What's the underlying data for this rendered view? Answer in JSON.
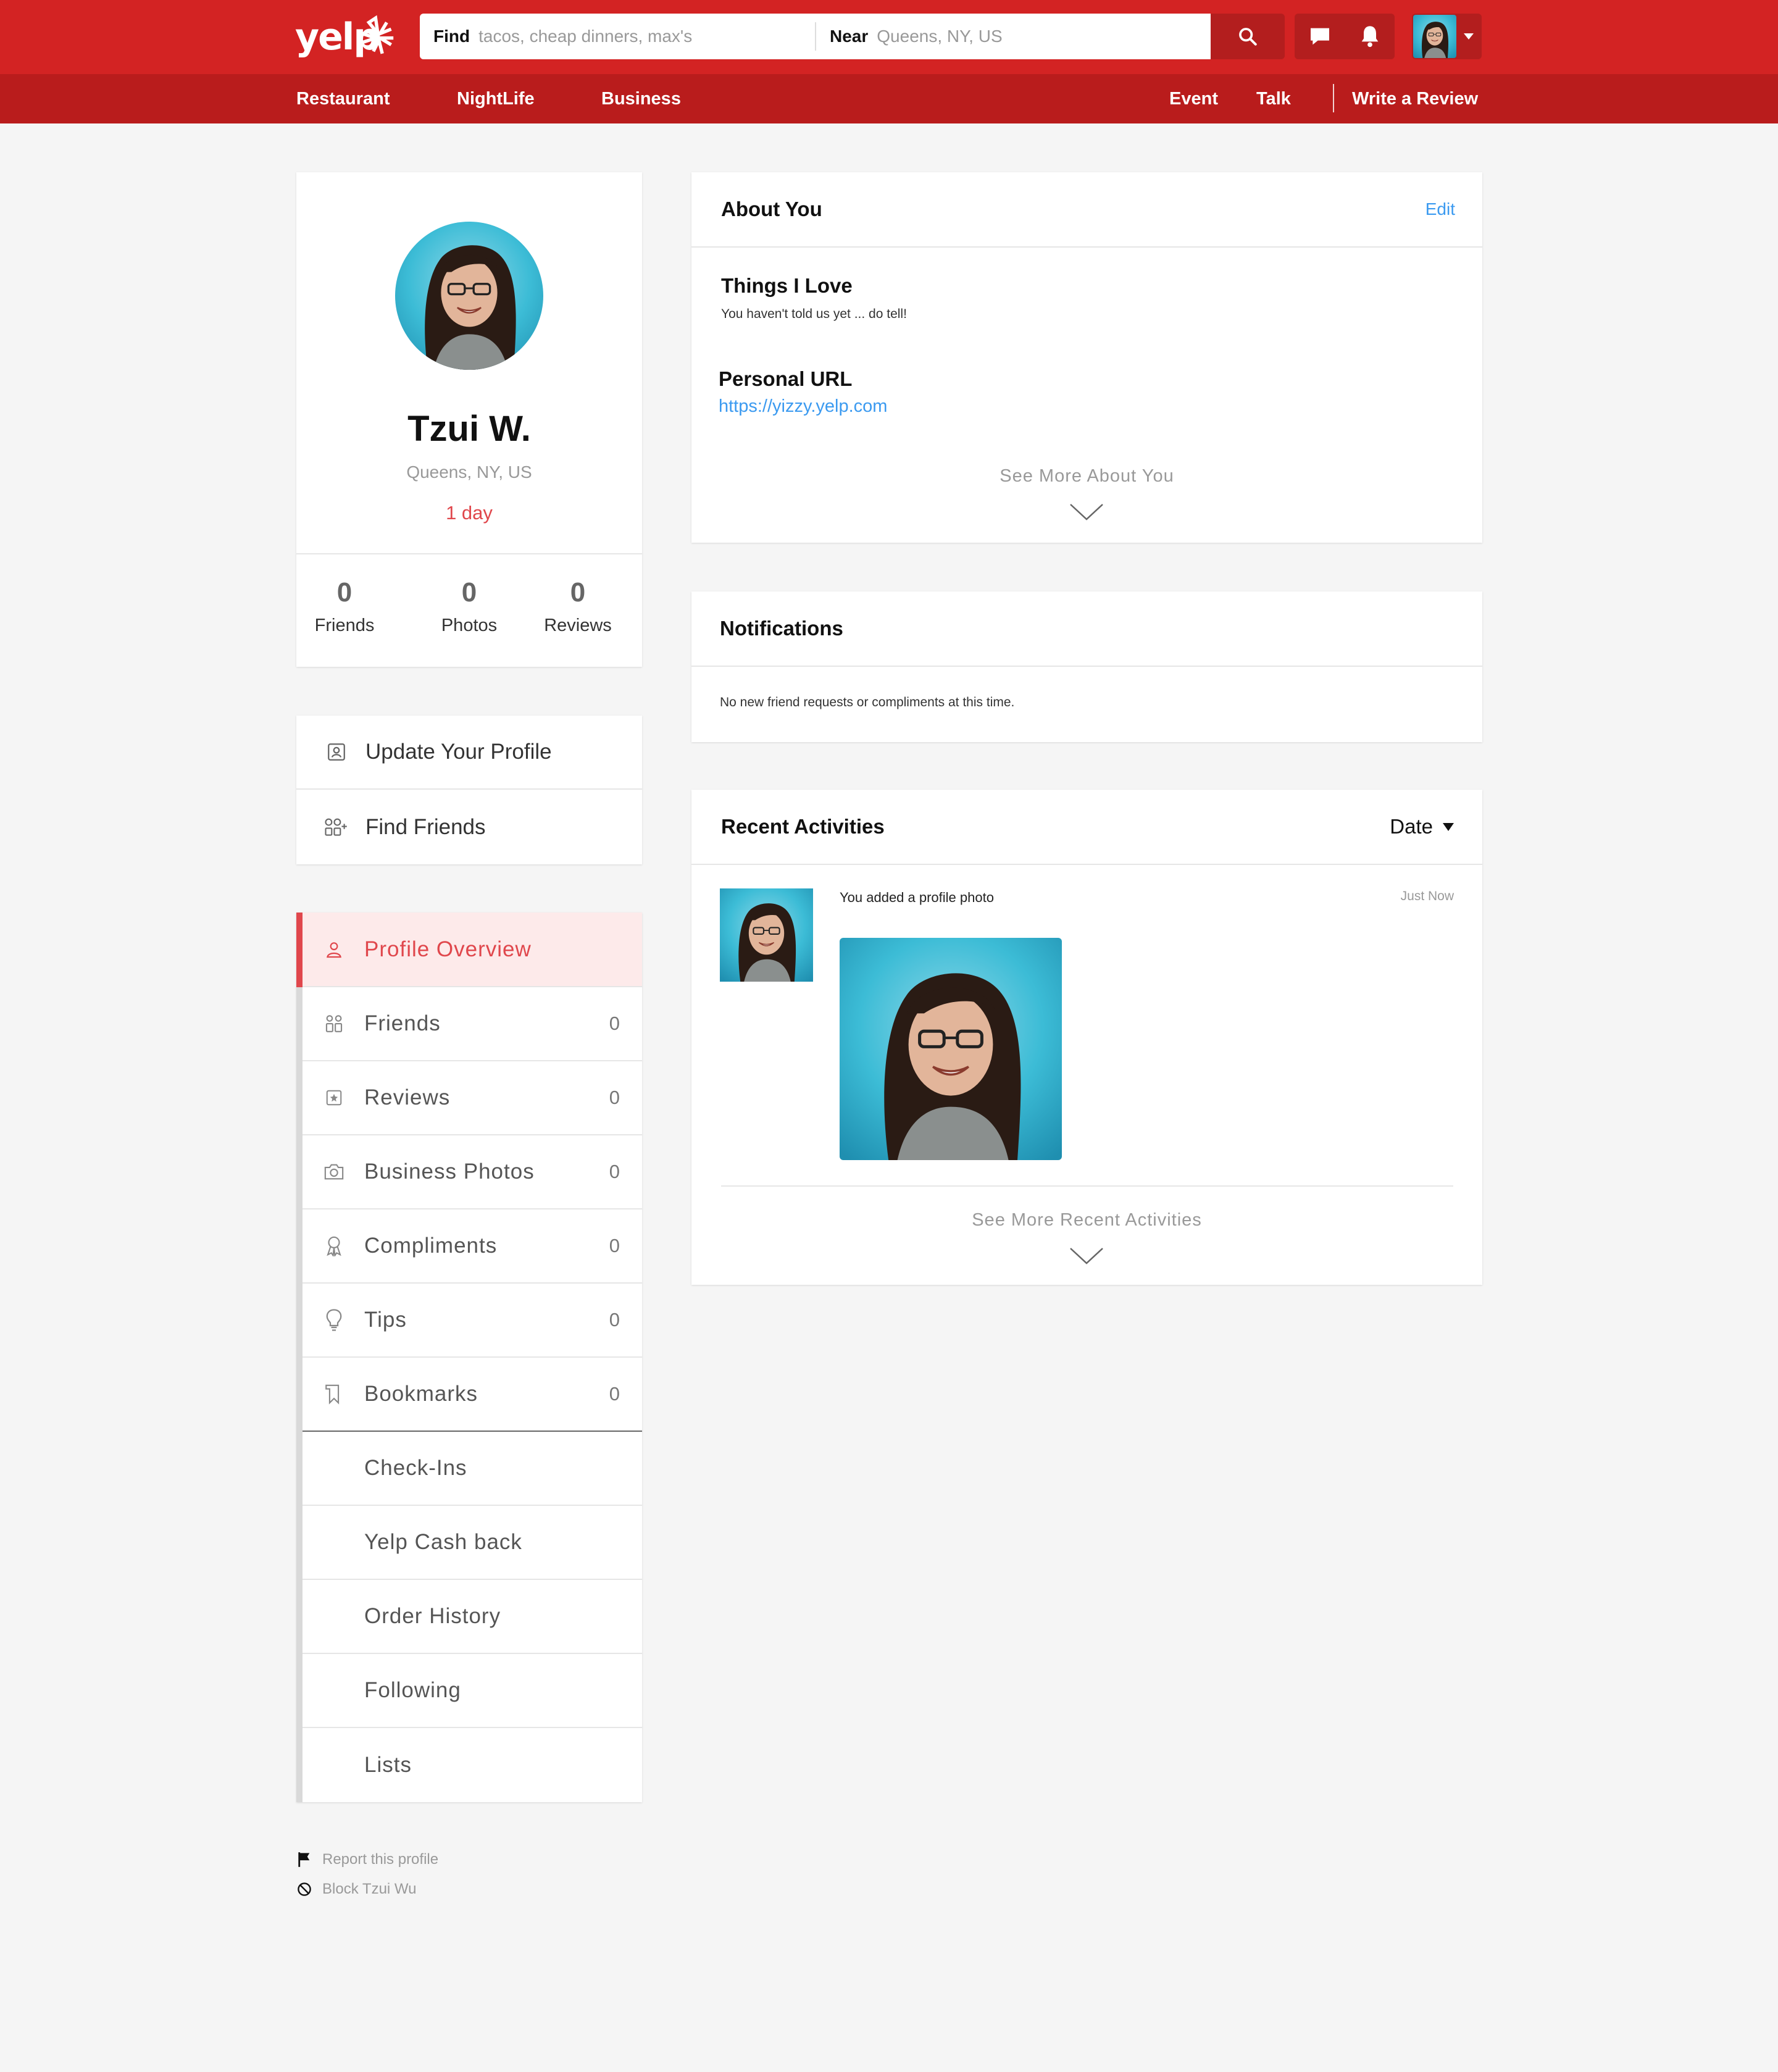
{
  "header": {
    "logo_text": "yelp",
    "search": {
      "find_label": "Find",
      "find_placeholder": "tacos, cheap dinners, max's",
      "near_label": "Near",
      "near_placeholder": "Queens, NY, US"
    },
    "brand_color": "#d32323"
  },
  "subnav": {
    "left": [
      "Restaurant",
      "NightLife",
      "Business"
    ],
    "right": [
      "Event",
      "Talk"
    ],
    "write_review": "Write a Review"
  },
  "profile": {
    "name": "Tzui W.",
    "location": "Queens, NY, US",
    "member_for": "1 day",
    "stats": [
      {
        "value": "0",
        "label": "Friends"
      },
      {
        "value": "0",
        "label": "Photos"
      },
      {
        "value": "0",
        "label": "Reviews"
      }
    ]
  },
  "actions": {
    "update_profile": "Update Your Profile",
    "find_friends": "Find Friends"
  },
  "menu": {
    "items": [
      {
        "label": "Profile Overview",
        "count": "",
        "icon": "user-icon"
      },
      {
        "label": "Friends",
        "count": "0",
        "icon": "friends-icon"
      },
      {
        "label": "Reviews",
        "count": "0",
        "icon": "star-icon"
      },
      {
        "label": "Business Photos",
        "count": "0",
        "icon": "camera-icon"
      },
      {
        "label": "Compliments",
        "count": "0",
        "icon": "award-icon"
      },
      {
        "label": "Tips",
        "count": "0",
        "icon": "lightbulb-icon"
      },
      {
        "label": "Bookmarks",
        "count": "0",
        "icon": "bookmark-icon"
      },
      {
        "label": "Check-Ins",
        "count": ""
      },
      {
        "label": "Yelp Cash back",
        "count": ""
      },
      {
        "label": "Order History",
        "count": ""
      },
      {
        "label": "Following",
        "count": ""
      },
      {
        "label": "Lists",
        "count": ""
      }
    ]
  },
  "footer": {
    "report": "Report this profile",
    "block": "Block Tzui Wu"
  },
  "about": {
    "title": "About You",
    "edit": "Edit",
    "things_title": "Things I Love",
    "things_text": "You haven't told us yet ... do tell!",
    "url_title": "Personal URL",
    "url_value": "https://yizzy.yelp.com",
    "see_more": "See More About You"
  },
  "notifications": {
    "title": "Notifications",
    "text": "No new friend requests or compliments at this time."
  },
  "recent": {
    "title": "Recent Activities",
    "sort": "Date",
    "activity_text": "You added a profile photo",
    "activity_time": "Just Now",
    "see_more": "See More Recent Activities"
  }
}
